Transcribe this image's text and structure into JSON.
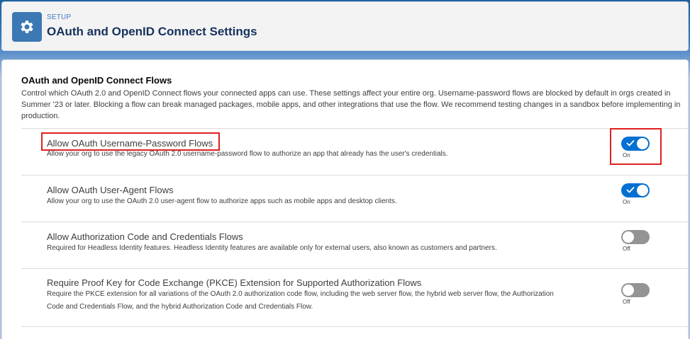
{
  "header": {
    "eyebrow": "SETUP",
    "title": "OAuth and OpenID Connect Settings",
    "icon": "gear-icon"
  },
  "section": {
    "title": "OAuth and OpenID Connect Flows",
    "description": "Control which OAuth 2.0 and OpenID Connect flows your connected apps can use. These settings affect your entire org. Username-password flows are blocked by default in orgs created in Summer '23 or later. Blocking a flow can break managed packages, mobile apps, and other integrations that use the flow. We recommend testing changes in a sandbox before implementing in production."
  },
  "settings": [
    {
      "label": "Allow OAuth Username-Password Flows",
      "description": "Allow your org to use the legacy OAuth 2.0 username-password flow to authorize an app that already has the user's credentials.",
      "enabled": true,
      "state": "On"
    },
    {
      "label": "Allow OAuth User-Agent Flows",
      "description": "Allow your org to use the OAuth 2.0 user-agent flow to authorize apps such as mobile apps and desktop clients.",
      "enabled": true,
      "state": "On"
    },
    {
      "label": "Allow Authorization Code and Credentials Flows",
      "description": "Required for Headless Identity features. Headless Identity features are available only for external users, also known as customers and partners.",
      "enabled": false,
      "state": "Off"
    },
    {
      "label": "Require Proof Key for Code Exchange (PKCE) Extension for Supported Authorization Flows",
      "description": "Require the PKCE extension for all variations of the OAuth 2.0 authorization code flow, including the web server flow, the hybrid web server flow, the Authorization Code and Credentials Flow, and the hybrid Authorization Code and Credentials Flow.",
      "enabled": false,
      "state": "Off"
    }
  ],
  "colors": {
    "toggle_on": "#0070d2",
    "toggle_off": "#969492",
    "highlight": "#e02020",
    "header_icon_bg": "#3c78b3"
  }
}
